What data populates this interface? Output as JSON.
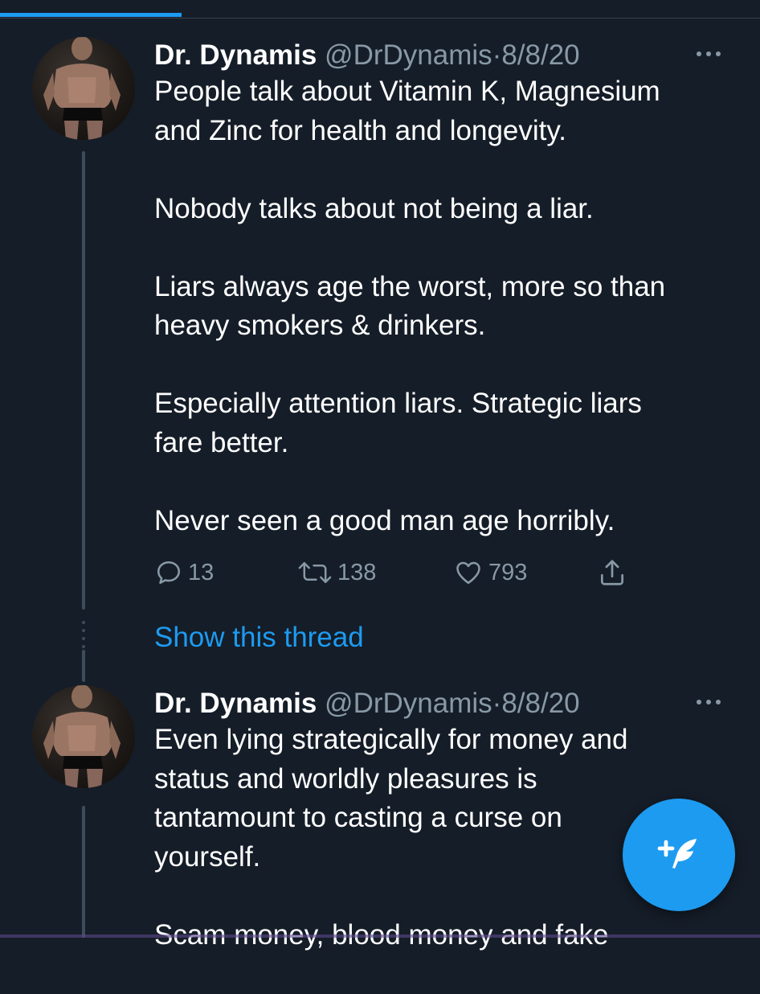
{
  "tweets": [
    {
      "author_name": "Dr. Dynamis",
      "handle": "@DrDynamis",
      "separator": "·",
      "date": "8/8/20",
      "paragraphs": [
        [
          "People talk about Vitamin K, Magnesium",
          "and Zinc for health and longevity."
        ],
        [
          "Nobody talks about not being a liar."
        ],
        [
          "Liars always age the worst, more so than",
          "heavy smokers & drinkers."
        ],
        [
          "Especially attention liars. Strategic liars",
          "fare better."
        ],
        [
          "Never seen a good man age horribly."
        ]
      ],
      "actions": {
        "reply_count": "13",
        "retweet_count": "138",
        "like_count": "793"
      },
      "show_thread": "Show this thread"
    },
    {
      "author_name": "Dr. Dynamis",
      "handle": "@DrDynamis",
      "separator": "·",
      "date": "8/8/20",
      "paragraphs": [
        [
          "Even lying strategically for money and",
          "status and worldly pleasures is",
          "tantamount to casting a curse on",
          "yourself."
        ],
        [
          "Scam money, blood money and fake"
        ]
      ]
    }
  ],
  "icons": {
    "more": "more-horizontal-icon",
    "reply": "reply-bubble-icon",
    "retweet": "retweet-icon",
    "like": "heart-icon",
    "share": "share-upload-icon",
    "compose": "compose-feather-icon"
  },
  "colors": {
    "background": "#151d28",
    "accent": "#1d9bf0",
    "secondary_text": "#8899a6",
    "primary_text": "#ffffff"
  }
}
